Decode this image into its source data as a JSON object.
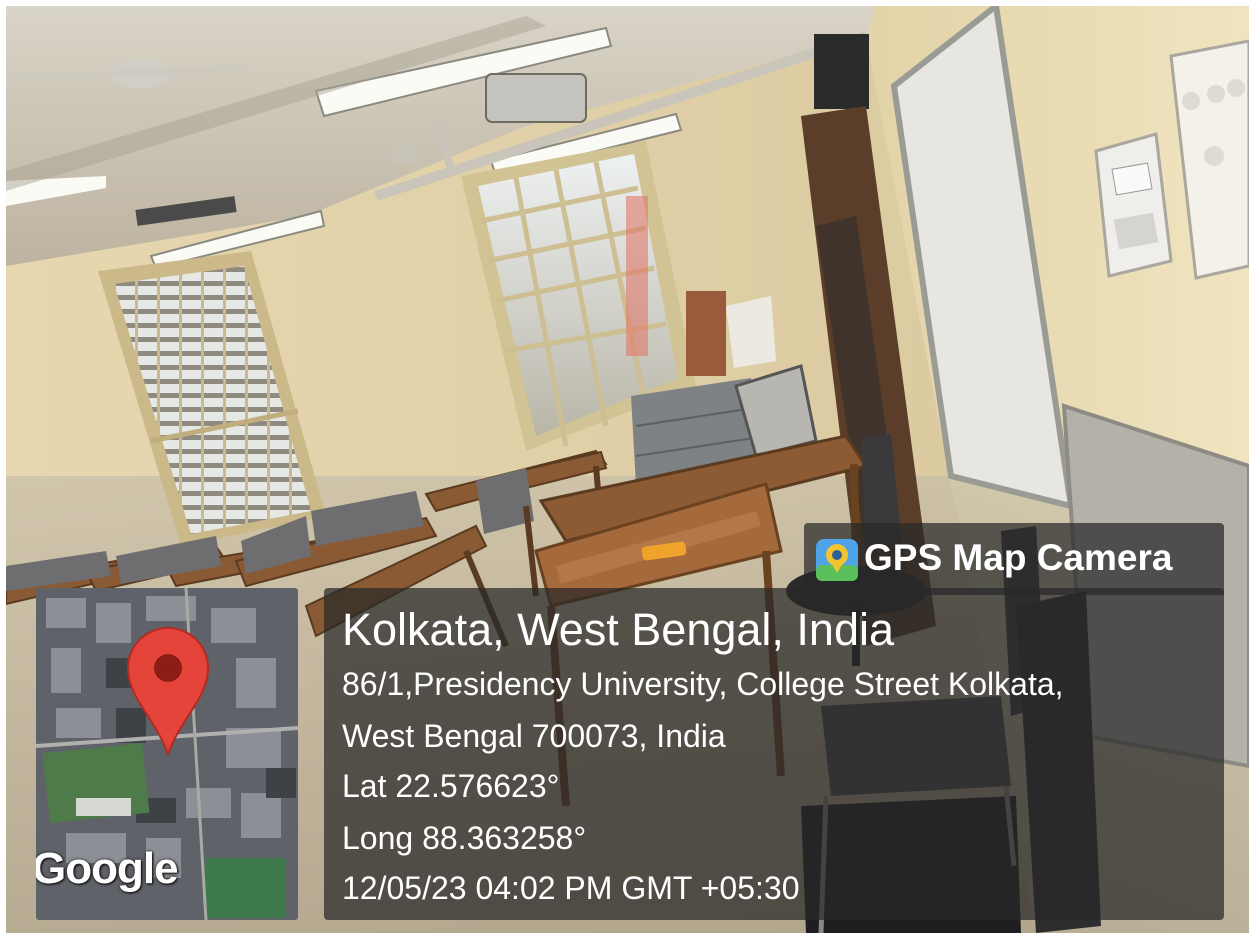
{
  "overlay": {
    "app_label": "GPS Map Camera",
    "location_title": "Kolkata, West Bengal, India",
    "address_line1": "86/1,Presidency University, College Street Kolkata,",
    "address_line2": "West Bengal 700073, India",
    "latitude": "Lat 22.576623°",
    "longitude": "Long 88.363258°",
    "datetime": "12/05/23 04:02 PM GMT +05:30"
  },
  "map": {
    "provider_logo": "Google",
    "pin_icon": "map-pin-icon",
    "pin_color": "#e5443a"
  },
  "colors": {
    "wall": "#e6d6ad",
    "panel_bg": "#282828"
  }
}
